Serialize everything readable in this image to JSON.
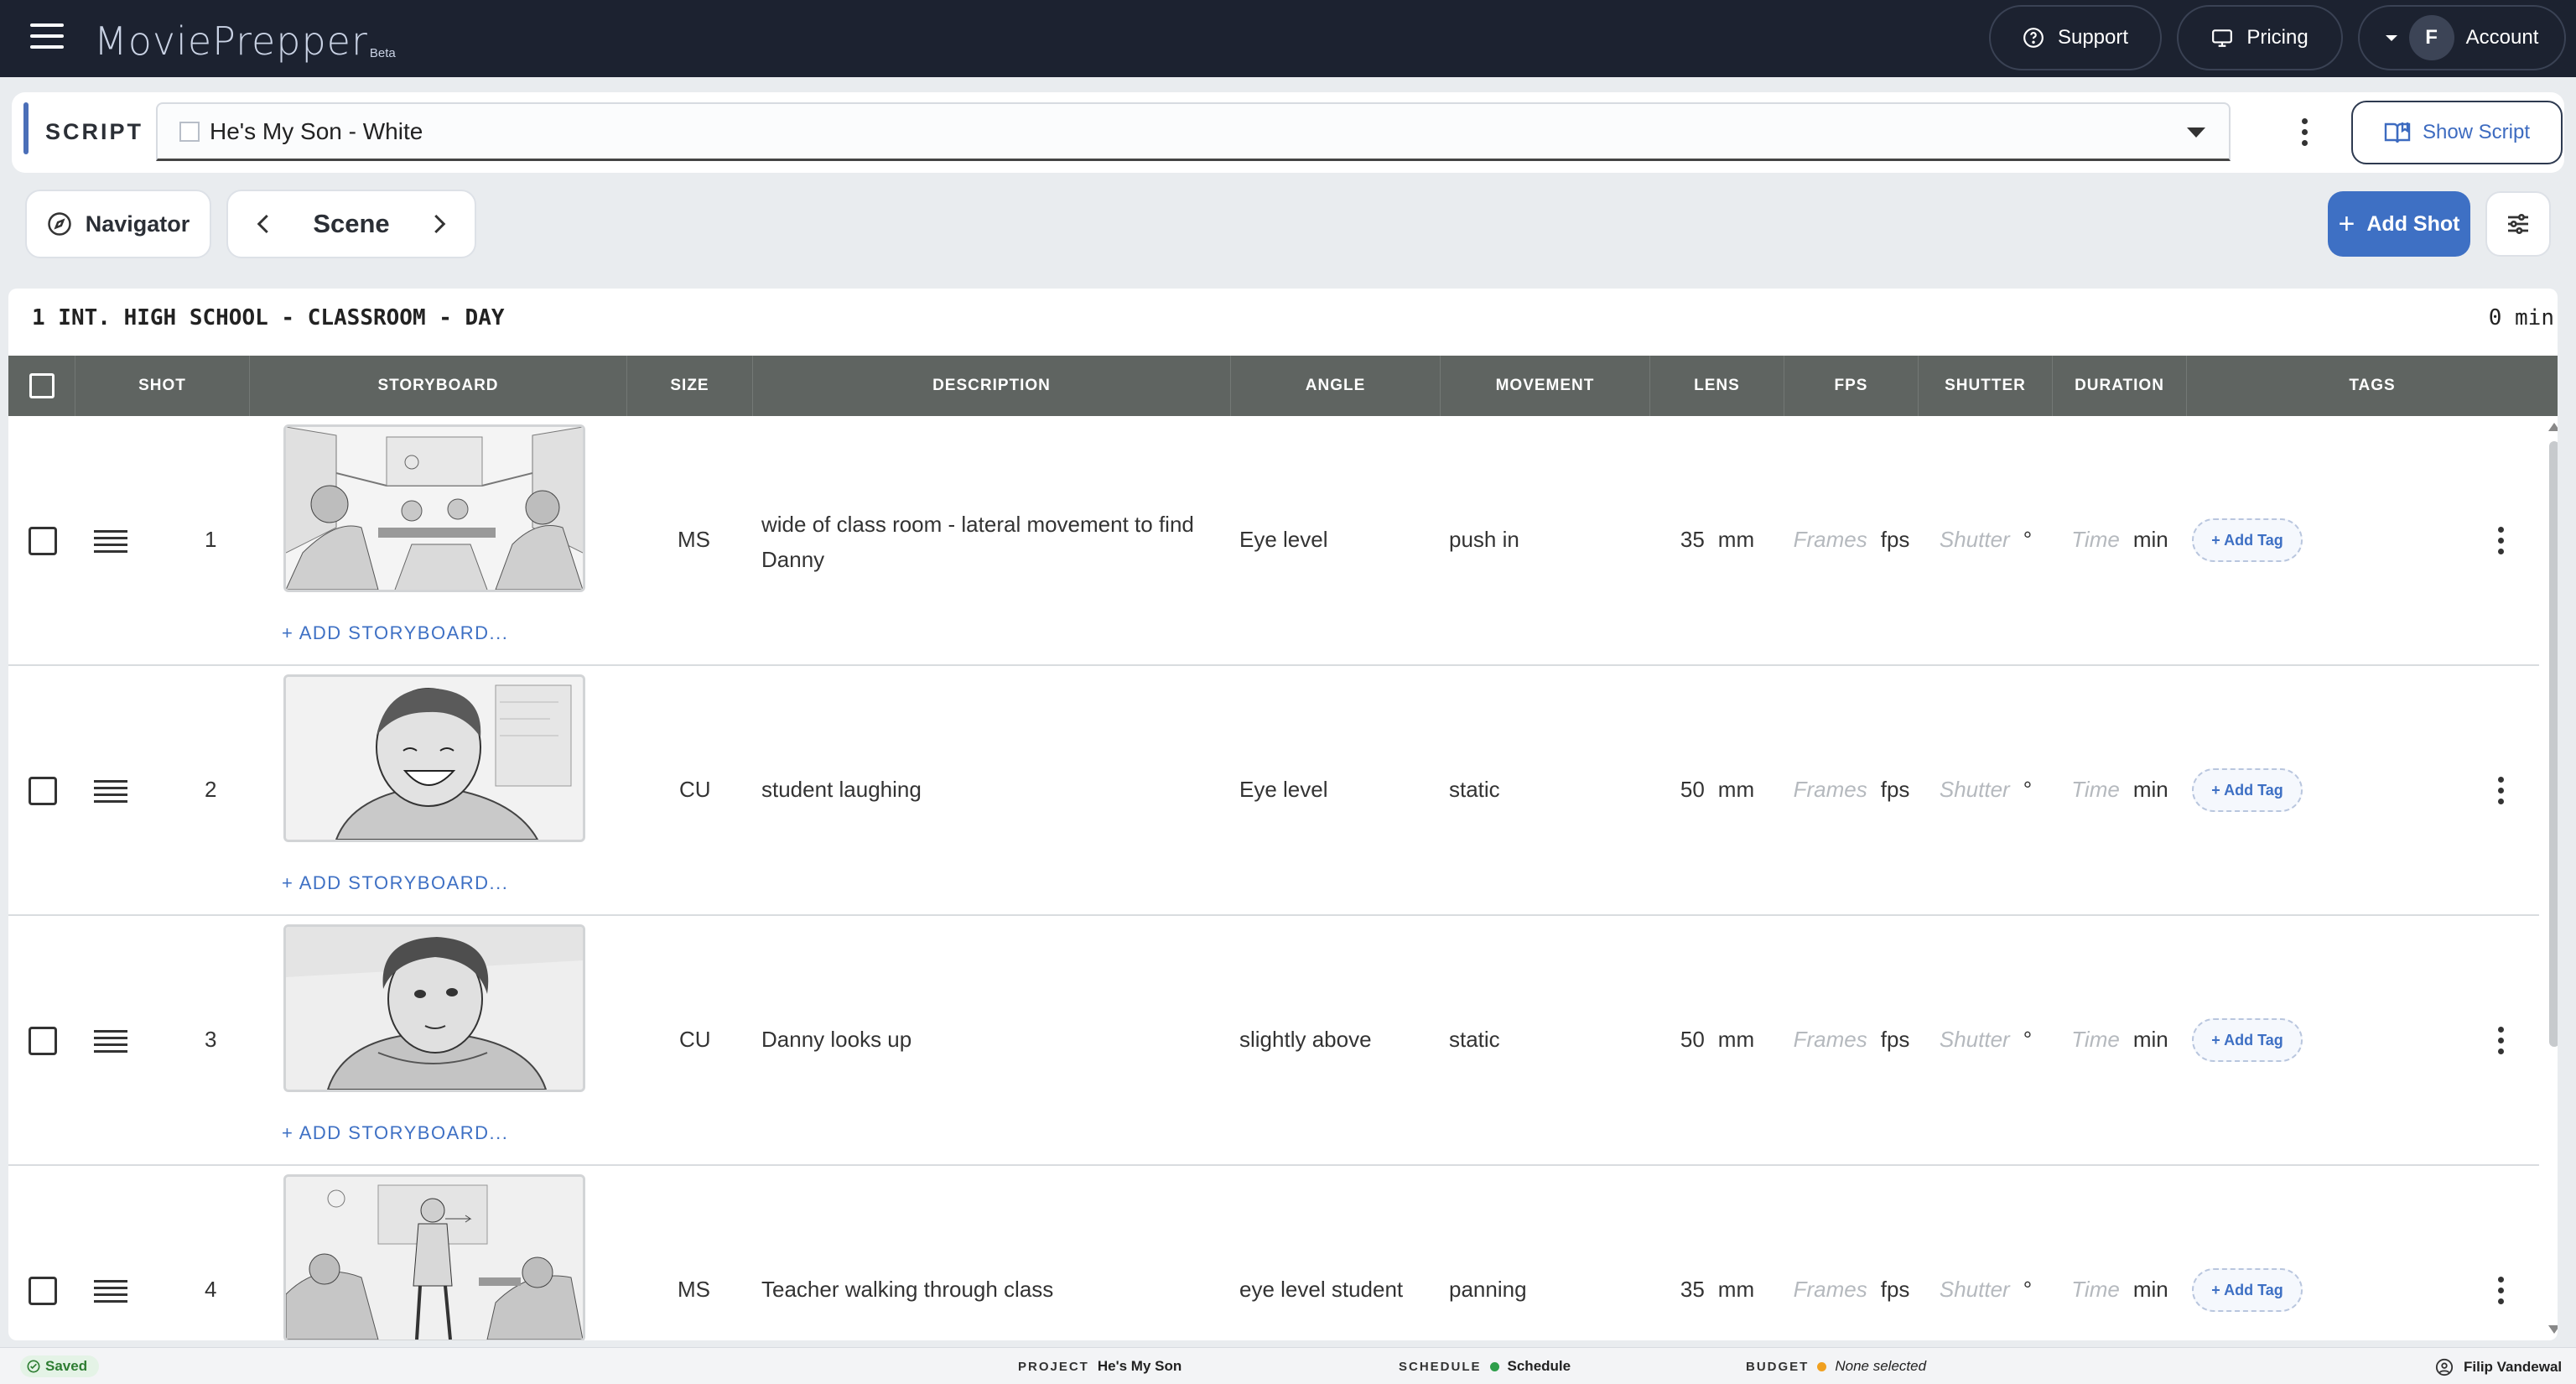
{
  "app": {
    "logo_text": "MoviePrepper",
    "logo_badge": "Beta"
  },
  "topnav": {
    "support_label": "Support",
    "pricing_label": "Pricing",
    "account_initial": "F",
    "account_label": "Account"
  },
  "script": {
    "section_label": "SCRIPT",
    "selected_script": "He's My Son - White",
    "show_script_label": "Show Script"
  },
  "toolbar": {
    "navigator_label": "Navigator",
    "scene_label": "Scene",
    "add_shot_label": "Add Shot"
  },
  "scene": {
    "heading": "1 INT. HIGH SCHOOL - CLASSROOM - DAY",
    "duration": "0 min"
  },
  "table": {
    "columns": [
      "SHOT",
      "STORYBOARD",
      "SIZE",
      "DESCRIPTION",
      "ANGLE",
      "MOVEMENT",
      "LENS",
      "FPS",
      "SHUTTER",
      "DURATION",
      "TAGS"
    ],
    "add_storyboard_label": "+ ADD STORYBOARD...",
    "add_tag_label": "+ Add Tag",
    "placeholders": {
      "fps": "Frames",
      "shutter": "Shutter",
      "duration": "Time"
    },
    "units": {
      "lens": "mm",
      "fps": "fps",
      "shutter": "°",
      "duration": "min"
    },
    "rows": [
      {
        "shot": "1",
        "size": "MS",
        "description": "wide of class room - lateral movement to find Danny",
        "angle": "Eye level",
        "movement": "push in",
        "lens": "35",
        "storyboard": "classroom-wide-sketch"
      },
      {
        "shot": "2",
        "size": "CU",
        "description": "student laughing",
        "angle": "Eye level",
        "movement": "static",
        "lens": "50",
        "storyboard": "student-laughing-sketch"
      },
      {
        "shot": "3",
        "size": "CU",
        "description": "Danny looks up",
        "angle": "slightly above",
        "movement": "static",
        "lens": "50",
        "storyboard": "danny-looks-up-sketch"
      },
      {
        "shot": "4",
        "size": "MS",
        "description": "Teacher walking through class",
        "angle": "eye level student",
        "movement": "panning",
        "lens": "35",
        "storyboard": "teacher-walking-sketch"
      }
    ]
  },
  "statusbar": {
    "saved_label": "Saved",
    "project_label": "PROJECT",
    "project_value": "He's My Son",
    "schedule_label": "SCHEDULE",
    "schedule_value": "Schedule",
    "schedule_color": "#2e9e4a",
    "budget_label": "BUDGET",
    "budget_value": "None selected",
    "budget_color": "#f0a020",
    "user_name": "Filip Vandewal"
  },
  "colors": {
    "navbar": "#1c2230",
    "accent": "#3e70c4",
    "table_header": "#5f6461"
  }
}
